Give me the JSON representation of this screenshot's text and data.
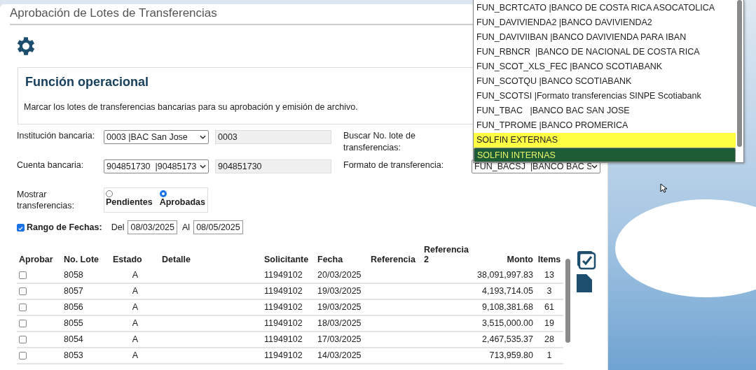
{
  "page": {
    "title": "Aprobación de Lotes de Transferencias"
  },
  "section": {
    "title": "Función operacional",
    "description": "Marcar los lotes de transferencias bancarias para su aprobación y emisión de archivo."
  },
  "form": {
    "institution": {
      "label": "Institución bancaria:",
      "value": "0003 |BAC San Jose",
      "code": "0003"
    },
    "account": {
      "label": "Cuenta bancaria:",
      "value": "904851730  |90485173",
      "code": "904851730"
    },
    "search": {
      "label": "Buscar No. lote de transferencias:"
    },
    "format": {
      "label": "Formato de transferencia:",
      "value": "FUN_BACSJ  |BANCO BAC S"
    },
    "show": {
      "label": "Mostrar transferencias:",
      "options": [
        {
          "label": "Pendientes",
          "selected": false
        },
        {
          "label": "Aprobadas",
          "selected": true
        }
      ]
    },
    "date_range": {
      "label": "Rango de Fechas:",
      "checked": true,
      "from_label": "Del",
      "from": "08/03/2025",
      "to_label": "Al",
      "to": "08/05/2025"
    }
  },
  "format_dropdown": {
    "options": [
      {
        "label": "FUN_BCRTCATO |BANCO DE COSTA RICA ASOCATOLICA",
        "hovered": false,
        "selected": false
      },
      {
        "label": "FUN_DAVIVIENDA2 |BANCO DAVIVIENDA2",
        "hovered": false,
        "selected": false
      },
      {
        "label": "FUN_DAVIVIIBAN |BANCO DAVIVIENDA PARA IBAN",
        "hovered": false,
        "selected": false
      },
      {
        "label": "FUN_RBNCR  |BANCO DE NACIONAL DE COSTA RICA",
        "hovered": false,
        "selected": false
      },
      {
        "label": "FUN_SCOT_XLS_FEC |BANCO SCOTIABANK",
        "hovered": false,
        "selected": false
      },
      {
        "label": "FUN_SCOTQU |BANCO SCOTIABANK",
        "hovered": false,
        "selected": false
      },
      {
        "label": "FUN_SCOTSI |Formato transferencias SINPE Scotiabank",
        "hovered": false,
        "selected": false
      },
      {
        "label": "FUN_TBAC   |BANCO BAC SAN JOSE",
        "hovered": false,
        "selected": false
      },
      {
        "label": "FUN_TPROME |BANCO PROMERICA",
        "hovered": false,
        "selected": false
      },
      {
        "label": "SOLFIN EXTERNAS",
        "hovered": true,
        "selected": false
      },
      {
        "label": "SOLFIN INTERNAS",
        "hovered": false,
        "selected": true
      }
    ]
  },
  "table": {
    "columns": [
      "Aprobar",
      "No. Lote",
      "Estado",
      "Detalle",
      "Solicitante",
      "Fecha",
      "Referencia",
      "Referencia 2",
      "Monto",
      "Items"
    ],
    "rows": [
      {
        "approve": false,
        "lote": "8058",
        "estado": "A",
        "solicitante": "11949102",
        "fecha": "20/03/2025",
        "monto": "38,091,997.83",
        "items": "13"
      },
      {
        "approve": false,
        "lote": "8057",
        "estado": "A",
        "solicitante": "11949102",
        "fecha": "19/03/2025",
        "monto": "4,193,714.05",
        "items": "3"
      },
      {
        "approve": false,
        "lote": "8056",
        "estado": "A",
        "solicitante": "11949102",
        "fecha": "19/03/2025",
        "monto": "9,108,381.68",
        "items": "61"
      },
      {
        "approve": false,
        "lote": "8055",
        "estado": "A",
        "solicitante": "11949102",
        "fecha": "18/03/2025",
        "monto": "3,515,000.00",
        "items": "19"
      },
      {
        "approve": false,
        "lote": "8054",
        "estado": "A",
        "solicitante": "11949102",
        "fecha": "17/03/2025",
        "monto": "2,467,535.37",
        "items": "28"
      },
      {
        "approve": false,
        "lote": "8053",
        "estado": "A",
        "solicitante": "11949102",
        "fecha": "14/03/2025",
        "monto": "713,959.80",
        "items": "1"
      }
    ]
  }
}
